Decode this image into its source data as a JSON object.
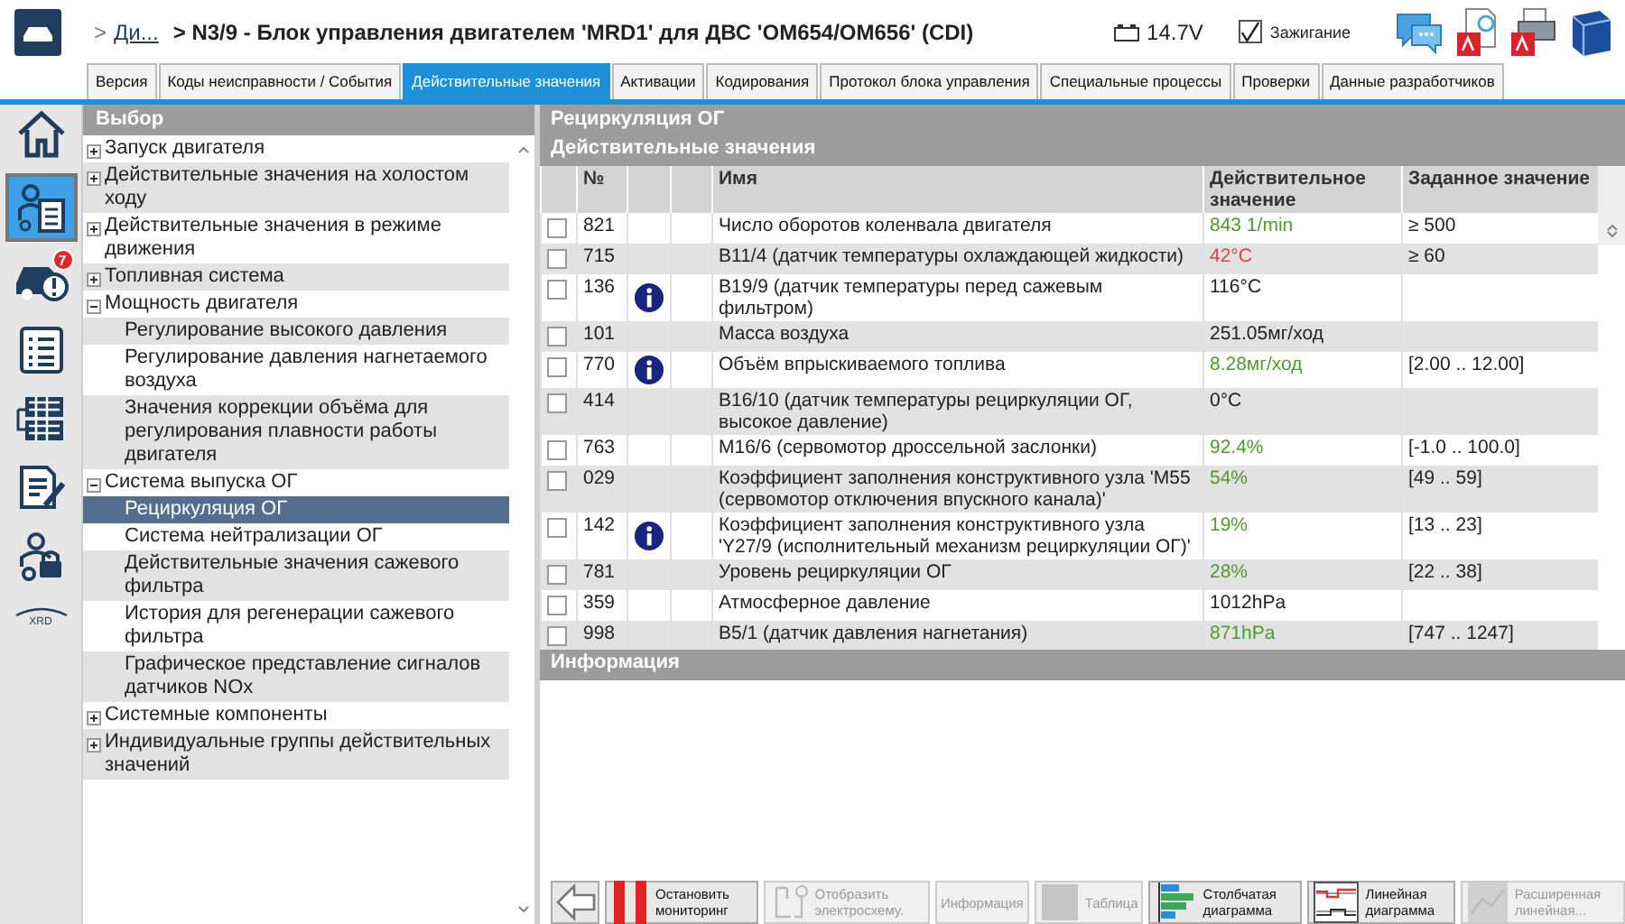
{
  "header": {
    "breadcrumb_prefix": ">",
    "breadcrumb_link": "Ди...",
    "title": "> N3/9 - Блок управления двигателем 'MRD1' для ДВС 'OM654/OM656' (CDI)",
    "voltage": "14.7V",
    "ignition": {
      "label": "Зажигание",
      "checked": true
    }
  },
  "tabs": [
    {
      "label": "Версия",
      "selected": false
    },
    {
      "label": "Коды неисправности / События",
      "selected": false
    },
    {
      "label": "Действительные значения",
      "selected": true
    },
    {
      "label": "Активации",
      "selected": false
    },
    {
      "label": "Кодирования",
      "selected": false
    },
    {
      "label": "Протокол блока управления",
      "selected": false
    },
    {
      "label": "Специальные процессы",
      "selected": false
    },
    {
      "label": "Проверки",
      "selected": false
    },
    {
      "label": "Данные разработчиков",
      "selected": false
    }
  ],
  "sidebar": {
    "items": [
      {
        "kind": "home",
        "selected": false
      },
      {
        "kind": "diagnosis",
        "selected": true
      },
      {
        "kind": "car",
        "selected": false,
        "badge": "7"
      },
      {
        "kind": "list",
        "selected": false
      },
      {
        "kind": "grid",
        "selected": false
      },
      {
        "kind": "document",
        "selected": false
      },
      {
        "kind": "lock",
        "selected": false
      },
      {
        "kind": "logo",
        "selected": false,
        "label": "XRD"
      }
    ]
  },
  "selection": {
    "title": "Выбор",
    "tree": [
      {
        "label": "Запуск двигателя",
        "expanded": false,
        "selected": false
      },
      {
        "label": "Действительные значения на холостом ходу",
        "expanded": false,
        "selected": false
      },
      {
        "label": "Действительные значения в режиме движения",
        "expanded": false,
        "selected": false
      },
      {
        "label": "Топливная система",
        "expanded": false,
        "selected": false
      },
      {
        "label": "Мощность двигателя",
        "expanded": true,
        "selected": false,
        "children": [
          {
            "label": "Регулирование высокого давления",
            "selected": false
          },
          {
            "label": "Регулирование давления нагнетаемого воздуха",
            "selected": false
          },
          {
            "label": "Значения коррекции объёма для регулирования плавности работы двигателя",
            "selected": false
          }
        ]
      },
      {
        "label": "Система выпуска ОГ",
        "expanded": true,
        "selected": false,
        "children": [
          {
            "label": "Рециркуляция ОГ",
            "selected": true
          },
          {
            "label": "Система нейтрализации ОГ",
            "selected": false
          },
          {
            "label": "Действительные значения сажевого фильтра",
            "selected": false
          },
          {
            "label": "История для регенерации сажевого фильтра",
            "selected": false
          },
          {
            "label": "Графическое представление сигналов датчиков NOx",
            "selected": false
          }
        ]
      },
      {
        "label": "Системные компоненты",
        "expanded": false,
        "selected": false
      },
      {
        "label": "Индивидуальные группы действительных значений",
        "expanded": false,
        "selected": false
      }
    ]
  },
  "values": {
    "title": "Рециркуляция ОГ",
    "subtitle": "Действительные значения",
    "columns": [
      "№",
      "Имя",
      "Действительное значение",
      "Заданное значение"
    ],
    "rows": [
      {
        "checked": false,
        "number": "821",
        "info": false,
        "name": "Число оборотов коленвала двигателя",
        "actual": "843 1/min",
        "color": "#4f9a2c",
        "target": "≥ 500"
      },
      {
        "checked": false,
        "number": "715",
        "info": false,
        "name": "B11/4 (датчик температуры охлаждающей жидкости)",
        "actual": "42°C",
        "color": "#d04848",
        "target": "≥ 60"
      },
      {
        "checked": false,
        "number": "136",
        "info": true,
        "name": "B19/9 (датчик температуры перед сажевым фильтром)",
        "actual": "116°C",
        "color": "#222222"
      },
      {
        "checked": false,
        "number": "101",
        "info": false,
        "name": "Масса воздуха",
        "actual": "251.05мг/ход",
        "color": "#222222"
      },
      {
        "checked": false,
        "number": "770",
        "info": true,
        "name": "Объём впрыскиваемого топлива",
        "actual": "8.28мг/ход",
        "color": "#4f9a2c",
        "target": "[2.00 .. 12.00]"
      },
      {
        "checked": false,
        "number": "414",
        "info": false,
        "name": "B16/10 (датчик температуры рециркуляции ОГ, высокое давление)",
        "actual": "0°C",
        "color": "#222222"
      },
      {
        "checked": false,
        "number": "763",
        "info": false,
        "name": "M16/6 (сервомотор дроссельной заслонки)",
        "actual": "92.4%",
        "color": "#4f9a2c",
        "target": "[-1.0 .. 100.0]"
      },
      {
        "checked": false,
        "number": "029",
        "info": false,
        "name": "Коэффициент заполнения конструктивного узла 'M55 (сервомотор отключения впускного канала)'",
        "actual": "54%",
        "color": "#4f9a2c",
        "target": "[49 .. 59]"
      },
      {
        "checked": false,
        "number": "142",
        "info": true,
        "name": "Коэффициент заполнения конструктивного узла 'Y27/9 (исполнительный механизм рециркуляции ОГ)'",
        "actual": "19%",
        "color": "#4f9a2c",
        "target": "[13 .. 23]"
      },
      {
        "checked": false,
        "number": "781",
        "info": false,
        "name": "Уровень рециркуляции ОГ",
        "actual": "28%",
        "color": "#4f9a2c",
        "target": "[22 .. 38]"
      },
      {
        "checked": false,
        "number": "359",
        "info": false,
        "name": "Атмосферное давление",
        "actual": "1012hPa",
        "color": "#222222"
      },
      {
        "checked": false,
        "number": "998",
        "info": false,
        "name": "B5/1 (датчик давления нагнетания)",
        "actual": "871hPa",
        "color": "#4f9a2c",
        "target": "[747 .. 1247]"
      }
    ]
  },
  "information": {
    "title": "Информация"
  },
  "toolbar": [
    {
      "kind": "back",
      "disabled": false
    },
    {
      "kind": "stop",
      "label": "Остановить мониторинг",
      "disabled": false
    },
    {
      "kind": "schema",
      "label": "Отобразить электросхему.",
      "disabled": true
    },
    {
      "kind": "text",
      "label": "Информация",
      "disabled": true
    },
    {
      "kind": "table",
      "label": "Таблица",
      "disabled": true
    },
    {
      "kind": "bars",
      "label": "Столбчатая диаграмма",
      "disabled": false
    },
    {
      "kind": "line",
      "label": "Линейная диаграмма",
      "disabled": false
    },
    {
      "kind": "extline",
      "label": "Расширенная линейная...",
      "disabled": true
    }
  ]
}
